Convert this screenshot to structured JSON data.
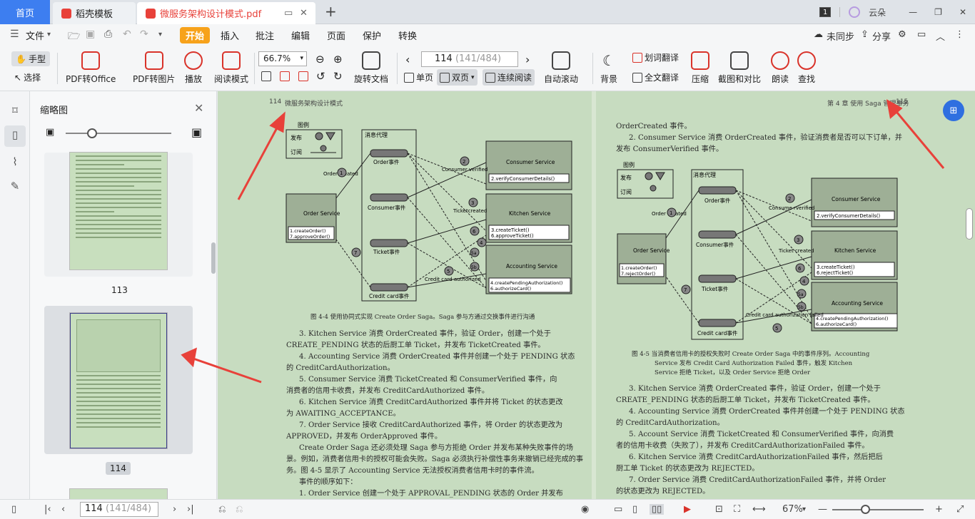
{
  "tabs": {
    "home": "首页",
    "template": "稻壳模板",
    "file": "微服务架构设计模式.pdf",
    "new": "+"
  },
  "titlebar": {
    "count": "1",
    "user": "云朵"
  },
  "menu": {
    "file": "文件",
    "items": [
      "开始",
      "插入",
      "批注",
      "编辑",
      "页面",
      "保护",
      "转换"
    ],
    "sync": "未同步",
    "share": "分享"
  },
  "toolbar": {
    "hand": "手型",
    "select": "选择",
    "pdf_office": "PDF转Office",
    "pdf_img": "PDF转图片",
    "play": "播放",
    "read_mode": "阅读模式",
    "zoom": "66.7%",
    "rotate": "旋转文档",
    "page_current": "114",
    "page_info": "(141/484)",
    "single": "单页",
    "double": "双页",
    "continuous": "连续阅读",
    "autoscroll": "自动滚动",
    "background": "背景",
    "word_translate": "划词翻译",
    "full_translate": "全文翻译",
    "compress": "压缩",
    "screenshot": "截图和对比",
    "read_aloud": "朗读",
    "find": "查找"
  },
  "sidebar": {
    "title": "缩略图",
    "thumb1_label": "113",
    "thumb2_label": "114"
  },
  "left_page": {
    "header_num": "114",
    "header_title": "微服务架构设计模式",
    "caption": "图 4-4   使用协同式实现 Create Order Saga。Saga 参与方通过交换事件进行沟通",
    "lines": [
      "3. Kitchen Service 消费 OrderCreated 事件，验证 Order，创建一个处于",
      "CREATE_PENDING 状态的后厨工单 Ticket，并发布 TicketCreated 事件。",
      "4. Accounting Service 消费 OrderCreated 事件并创建一个处于 PENDING 状态",
      "的 CreditCardAuthorization。",
      "5. Consumer Service 消费 TicketCreated 和 ConsumerVerified 事件，向",
      "消费者的信用卡收费，并发布 CreditCardAuthorized 事件。",
      "6. Kitchen Service 消费 CreditCardAuthorized 事件并将 Ticket 的状态更改",
      "为 AWAITING_ACCEPTANCE。",
      "7. Order Service 接收 CreditCardAuthorized 事件，将 Order 的状态更改为",
      "APPROVED，并发布 OrderApproved 事件。",
      "Create Order Saga 还必须处理 Saga 参与方拒绝 Order 并发布某种失败事件的场",
      "景。例如，消费者信用卡的授权可能会失败。Saga 必须执行补偿性事务来撤销已经完成的事",
      "务。图 4-5 显示了 Accounting Service 无法授权消费者信用卡时的事件流。",
      "事件的顺序如下：",
      "1. Order Service 创建一个处于 APPROVAL_PENDING 状态的 Order 并发布"
    ],
    "diagram": {
      "legend": "图例",
      "publish": "发布",
      "subscribe": "订阅",
      "broker": "消息代理",
      "order_event": "Order事件",
      "consumer_event": "Consumer事件",
      "ticket_event": "Ticket事件",
      "card_event": "Credit card事件",
      "order_created": "Order created",
      "consumer_verified": "Consumer verified",
      "ticket_created": "Ticketcreated",
      "card_authorized": "Credit card authorized",
      "consumer_service": "Consumer Service",
      "consumer_op": "2.verifyConsumerDetails()",
      "kitchen_service": "Kitchen Service",
      "kitchen_ops": [
        "3.createTicket()",
        "6.approveTicket()"
      ],
      "accounting_service": "Accounting Service",
      "accounting_ops": [
        "4.createPendingAuthorization()",
        "6.authorizeCard()"
      ],
      "order_service": "Order Service",
      "order_ops": [
        "1.createOrder()",
        "7.approveOrder()"
      ],
      "steps": [
        "1",
        "2",
        "3",
        "4",
        "5",
        "6",
        "7",
        "5a",
        "5b"
      ]
    }
  },
  "right_page": {
    "header_chapter": "第 4 章  使用 Saga 管理事务",
    "header_num": "115",
    "top_lines": [
      "OrderCreated 事件。",
      "2. Consumer Service 消费 OrderCreated 事件，验证消费者是否可以下订单，并",
      "发布 ConsumerVerified 事件。"
    ],
    "caption_lines": [
      "图 4-5   当消费者信用卡的授权失败时 Create Order Saga 中的事件序列。Accounting",
      "Service 发布 Credit Card Authorization Failed 事件，触发 Kitchen",
      "Service 拒绝 Ticket，以及 Order Service 拒绝 Order"
    ],
    "lines": [
      "3. Kitchen Service 消费 OrderCreated 事件，验证 Order，创建一个处于",
      "CREATE_PENDING 状态的后厨工单 Ticket，并发布 TicketCreated 事件。",
      "4. Accounting Service 消费 OrderCreated 事件并创建一个处于 PENDING 状态",
      "的 CreditCardAuthorization。",
      "5. Account Service 消费 TicketCreated 和 ConsumerVerified 事件，向消费",
      "者的信用卡收费（失败了），并发布 CreditCardAuthorizationFailed 事件。",
      "6. Kitchen Service 消费 CreditCardAuthorizationFailed 事件，然后把后",
      "厨工单 Ticket 的状态更改为 REJECTED。",
      "7. Order Service 消费 CreditCardAuthorizationFailed 事件，并将 Order",
      "的状态更改为 REJECTED。"
    ],
    "diagram": {
      "legend": "图例",
      "publish": "发布",
      "subscribe": "订阅",
      "broker": "消息代理",
      "order_event": "Order事件",
      "consumer_event": "Consumer事件",
      "ticket_event": "Ticket事件",
      "card_event": "Credit card事件",
      "order_created": "Order created",
      "consumer_verified": "Consume rverified",
      "ticket_created": "Ticket created",
      "card_failed": "Credit card authorization failed",
      "consumer_service": "Consumer Service",
      "consumer_op": "2.verifyConsumerDetails()",
      "kitchen_service": "Kitchen Service",
      "kitchen_ops": [
        "3.createTicket()",
        "6.rejectTicket()"
      ],
      "accounting_service": "Accounting Service",
      "accounting_ops": [
        "4.createPendingAuthorization()",
        "6.authorizeCard()"
      ],
      "order_service": "Order Service",
      "order_ops": [
        "1.createOrder()",
        "7.rejectOrder()"
      ],
      "steps": [
        "1",
        "2",
        "3",
        "4",
        "5",
        "6",
        "7",
        "5a",
        "5b"
      ]
    }
  },
  "statusbar": {
    "page_current": "114",
    "page_info": "(141/484)",
    "zoom": "67%"
  },
  "colors": {
    "accent": "#3d7ef0",
    "start": "#f7a21b",
    "doc_bg": "#c7dcc0",
    "arrow": "#e8413a"
  }
}
